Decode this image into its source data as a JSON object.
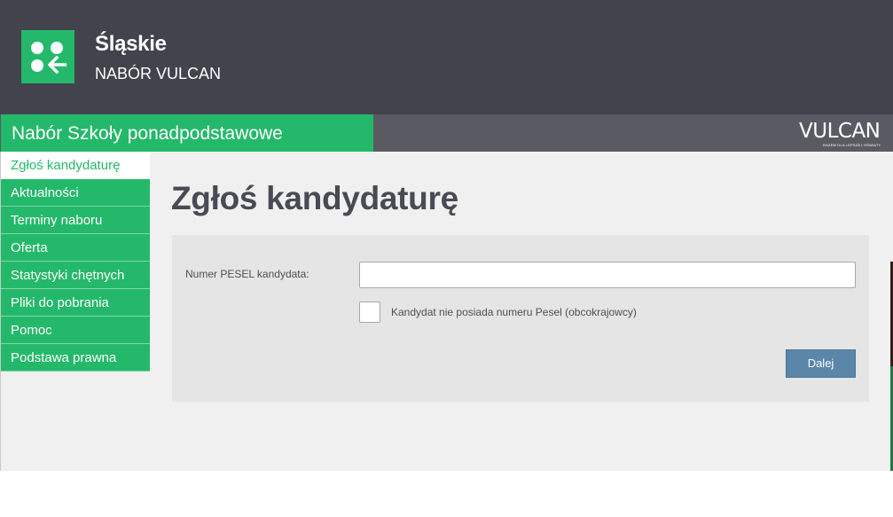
{
  "header": {
    "region_title": "Śląskie",
    "region_subtitle": "NABÓR VULCAN",
    "logo_icon": "people-arrow-logo-icon"
  },
  "subbar": {
    "app_title": "Nabór Szkoły ponadpodstawowe",
    "brand_name": "VULCAN",
    "brand_tagline": "RAZEM DLA LEPSZEJ OŚWIATY"
  },
  "sidebar": {
    "items": [
      {
        "label": "Zgłoś kandydaturę",
        "active": true
      },
      {
        "label": "Aktualności",
        "active": false
      },
      {
        "label": "Terminy naboru",
        "active": false
      },
      {
        "label": "Oferta",
        "active": false
      },
      {
        "label": "Statystyki chętnych",
        "active": false
      },
      {
        "label": "Pliki do pobrania",
        "active": false
      },
      {
        "label": "Pomoc",
        "active": false
      },
      {
        "label": "Podstawa prawna",
        "active": false
      }
    ]
  },
  "main": {
    "page_title": "Zgłoś kandydaturę",
    "form": {
      "pesel_label": "Numer PESEL kandydata:",
      "pesel_value": "",
      "no_pesel_label": "Kandydat nie posiada numeru Pesel (obcokrajowcy)",
      "no_pesel_checked": false,
      "next_button_label": "Dalej"
    }
  },
  "colors": {
    "brand_green": "#24b96a",
    "header_dark": "#43434d",
    "subbar_gray": "#5a5a63",
    "button_blue": "#5a86a9",
    "content_bg": "#f0f0f0"
  }
}
